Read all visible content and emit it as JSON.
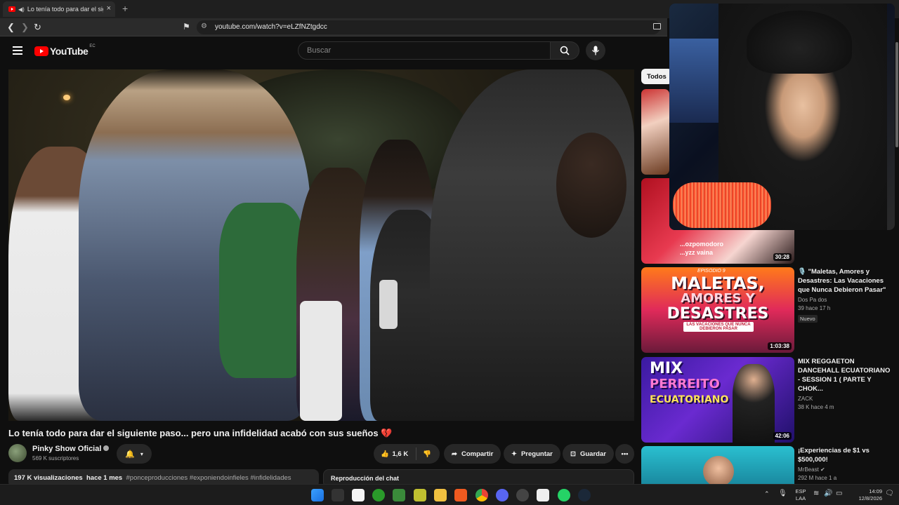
{
  "browser": {
    "tab_title": "Lo tenía todo para dar el siguiente paso... pero una infidelidad acabó con sus sueños",
    "tab_close": "×",
    "new_tab": "+",
    "url": "youtube.com/watch?v=eLZfNZtgdcc"
  },
  "header": {
    "logo_text": "YouTube",
    "country_code": "EC",
    "search_placeholder": "Buscar"
  },
  "video": {
    "title": "Lo tenía todo para dar el siguiente paso... pero una infidelidad acabó con sus sueños 💔",
    "channel": "Pinky Show Oficial",
    "subscribers": "569 K suscriptores",
    "likes": "1,6 K",
    "share_label": "Compartir",
    "ask_label": "Preguntar",
    "save_label": "Guardar",
    "views": "197 K visualizaciones",
    "age": "hace 1 mes",
    "hashtags": "#ponceproducciones #exponiendoinfieles #infidelidades",
    "chat_replay": "Reproducción del chat"
  },
  "chips": [
    "Todos"
  ],
  "recommendations": [
    {
      "title": "",
      "channel": "",
      "meta": "",
      "duration": ""
    },
    {
      "title": "",
      "channel": "",
      "meta": "",
      "duration": "30:28",
      "overlay_lines": [
        "...ozpomodoro",
        "...yzz vaina"
      ]
    },
    {
      "title": "🎙️ \"Maletas, Amores y Desastres: Las Vacaciones que Nunca Debieron Pasar\"",
      "channel": "Dos Pa dos",
      "meta": "39  hace 17 h",
      "badge": "Nuevo",
      "duration": "1:03:38",
      "thumb_text": [
        "MALETAS,",
        "AMORES Y",
        "DESASTRES"
      ],
      "thumb_sub": "LAS VACACIONES QUE NUNCA DEBIERON PASAR",
      "episode": "EPISODIO 9"
    },
    {
      "title": "MIX REGGAETON DANCEHALL ECUATORIANO - SESSION 1 ( PARTE Y CHOK...",
      "channel": "ZACK",
      "meta": "38 K  hace 4 m",
      "duration": "42:06",
      "thumb_text": [
        "MIX",
        "PERREITO",
        "ECUATORIANO"
      ]
    },
    {
      "title": "¡Experiencias de $1 vs $500,000!",
      "channel": "MrBeast",
      "meta": "292 M  hace 1 a",
      "duration": ""
    }
  ],
  "taskbar": {
    "lang_top": "ESP",
    "lang_bottom": "LAA",
    "time": "14:09",
    "date": "12/8/2026"
  }
}
